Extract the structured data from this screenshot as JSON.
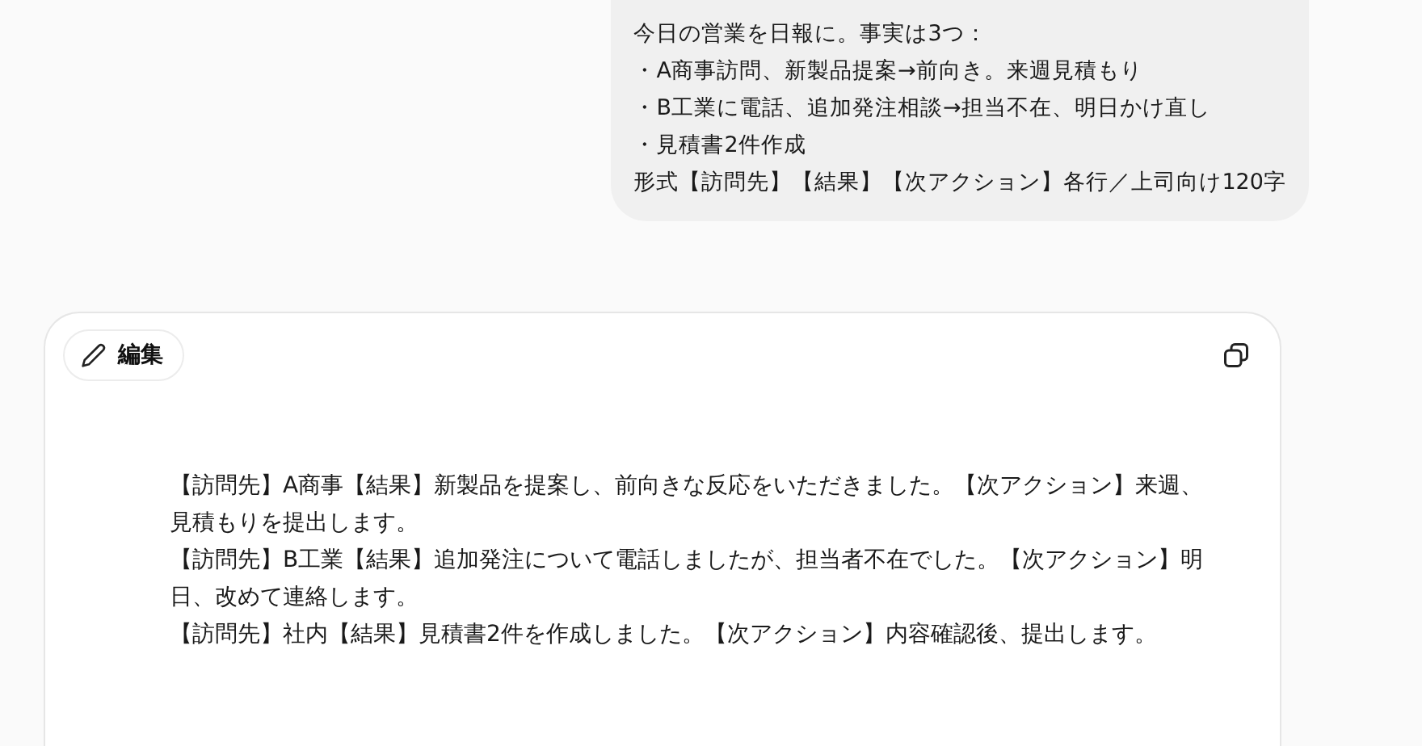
{
  "user_message": {
    "lines": [
      "今日の営業を日報に。事実は3つ：",
      "・A商事訪問、新製品提案→前向き。来週見積もり",
      "・B工業に電話、追加発注相談→担当不在、明日かけ直し",
      "・見積書2件作成",
      "形式【訪問先】【結果】【次アクション】各行／上司向け120字"
    ]
  },
  "response": {
    "edit_button": "編集",
    "paragraphs": [
      "【訪問先】A商事【結果】新製品を提案し、前向きな反応をいただきました。【次アクション】来週、見積もりを提出します。",
      "【訪問先】B工業【結果】追加発注について電話しましたが、担当者不在でした。【次アクション】明日、改めて連絡します。",
      "【訪問先】社内【結果】見積書2件を作成しました。【次アクション】内容確認後、提出します。"
    ]
  }
}
